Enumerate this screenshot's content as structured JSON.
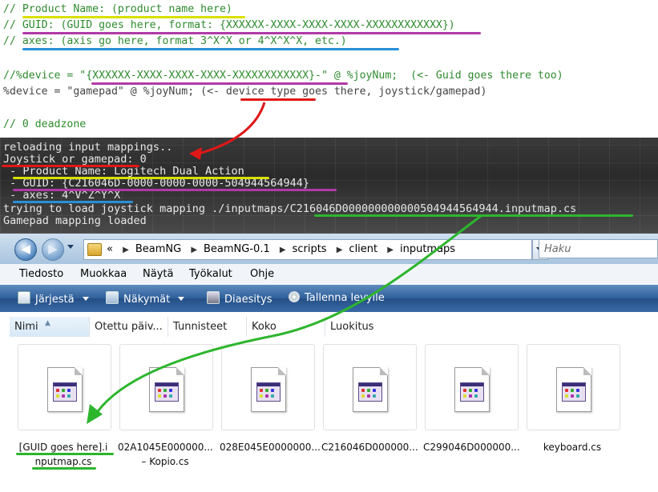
{
  "code_panel": {
    "lines": [
      "// Product Name: (product name here)",
      "// GUID: (GUID goes here, format: {XXXXXX-XXXX-XXXX-XXXX-XXXXXXXXXXXX})",
      "// axes: (axis go here, format 3^X^X or 4^X^X^X, etc.)",
      "//%device = \"{XXXXXX-XXXX-XXXX-XXXX-XXXXXXXXXXXX}-\" @ %joyNum;  (<- Guid goes there too)",
      "%device = \"gamepad\" @ %joyNum; (<- device type goes there, joystick/gamepad)",
      "// 0 deadzone"
    ]
  },
  "console": {
    "lines": [
      "reloading input mappings..",
      "Joystick or gamepad: 0",
      " - Product Name: Logitech Dual Action",
      " - GUID: {C216046D-0000-0000-0000-504944564944}",
      " - axes: 4^V^Z^Y^X",
      "trying to load joystick mapping ./inputmaps/C216046D000000000000504944564944.inputmap.cs",
      "Gamepad mapping loaded"
    ]
  },
  "explorer": {
    "breadcrumb_prefix": "«",
    "breadcrumb": [
      "BeamNG",
      "BeamNG-0.1",
      "scripts",
      "client",
      "inputmaps"
    ],
    "search_placeholder": "Haku",
    "menu": [
      "Tiedosto",
      "Muokkaa",
      "Näytä",
      "Työkalut",
      "Ohje"
    ],
    "commands": [
      "Järjestä",
      "Näkymät",
      "Diaesitys",
      "Tallenna levylle"
    ],
    "columns": [
      "Nimi",
      "Otettu päiv...",
      "Tunnisteet",
      "Koko",
      "Luokitus"
    ],
    "files": [
      {
        "line1": "[GUID goes here].i",
        "line2": "nputmap.cs"
      },
      {
        "line1": "02A1045E000000...",
        "line2": "– Kopio.cs"
      },
      {
        "line1": "028E045E0000000...",
        "line2": ""
      },
      {
        "line1": "C216046D000000...",
        "line2": ""
      },
      {
        "line1": "C299046D000000...",
        "line2": ""
      },
      {
        "line1": "keyboard.cs",
        "line2": ""
      }
    ]
  },
  "colors": {
    "annot_yellow": "#d8e000",
    "annot_magenta": "#b03aa8",
    "annot_blue": "#2a8fd8",
    "annot_red": "#e01818",
    "annot_green": "#2db52d"
  }
}
